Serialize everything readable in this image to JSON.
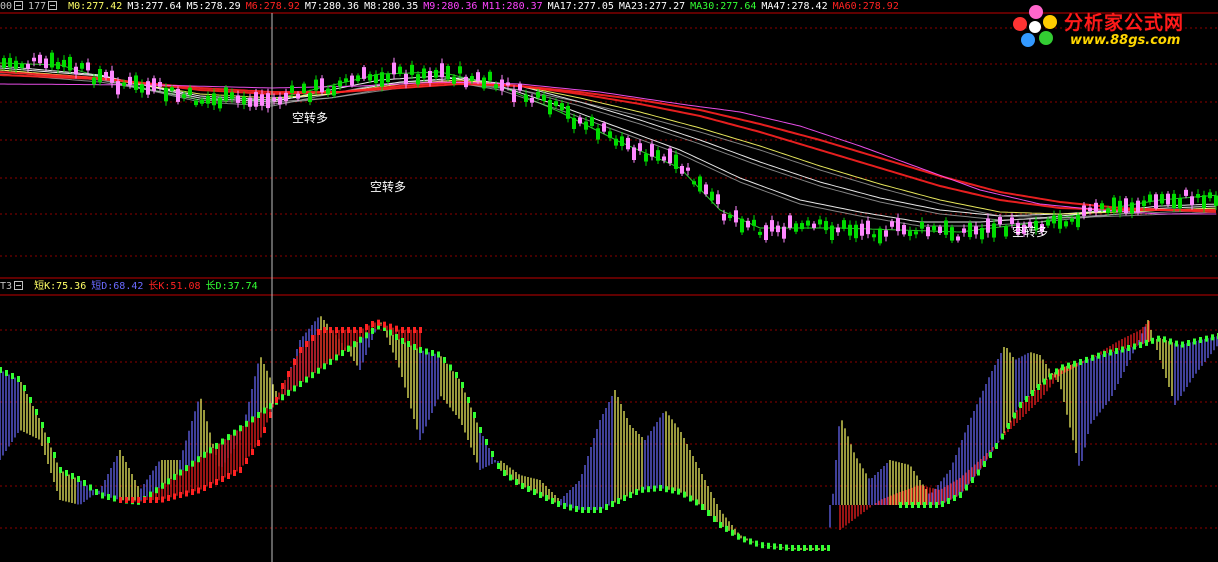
{
  "upper_panel": {
    "id_label": "00",
    "formula_label": "177",
    "indicators": [
      {
        "label": "M0:277.42",
        "color": "#ffff66"
      },
      {
        "label": "M3:277.64",
        "color": "#ffffff"
      },
      {
        "label": "M5:278.29",
        "color": "#ffffff"
      },
      {
        "label": "M6:278.92",
        "color": "#ff2222"
      },
      {
        "label": "M7:280.36",
        "color": "#ffffff"
      },
      {
        "label": "M8:280.35",
        "color": "#ffffff"
      },
      {
        "label": "M9:280.36",
        "color": "#ff44ff"
      },
      {
        "label": "M11:280.37",
        "color": "#ff44ff"
      },
      {
        "label": "MA17:277.05",
        "color": "#ffffff"
      },
      {
        "label": "MA23:277.27",
        "color": "#ffffff"
      },
      {
        "label": "MA30:277.64",
        "color": "#33ff33"
      },
      {
        "label": "MA47:278.42",
        "color": "#ffffff"
      },
      {
        "label": "MA60:278.92",
        "color": "#ff2222"
      }
    ],
    "annotations": [
      {
        "text": "空转多",
        "color": "#ffffff"
      },
      {
        "text": "空转多",
        "color": "#ffffff"
      },
      {
        "text": "空转多",
        "color": "#ffffff"
      }
    ]
  },
  "lower_panel": {
    "id_label": "T3",
    "indicators": [
      {
        "label": "短K:75.36",
        "color": "#ffff66"
      },
      {
        "label": "短D:68.42",
        "color": "#6a6aff"
      },
      {
        "label": "长K:51.08",
        "color": "#ff2222"
      },
      {
        "label": "长D:37.74",
        "color": "#33ff33"
      }
    ]
  },
  "logo": {
    "title": "分析家公式网",
    "url": "www.88gs.com"
  },
  "colors": {
    "background": "#000000",
    "grid": "#8b0000",
    "separator": "#c00000",
    "cursor": "#c0c0c0",
    "candle_up": "#ff88ff",
    "candle_down": "#00dd00",
    "short_k_rising": "#6a6aff",
    "short_k_falling": "#ffff66",
    "long_k_rising": "#ff2222",
    "long_d": "#33ff33"
  },
  "chart_data": [
    {
      "type": "candlestick",
      "title": "",
      "panel": "upper",
      "series": [
        {
          "name": "M0",
          "y_at_x": [
            [
              0,
              63
            ],
            [
              60,
              65
            ],
            [
              120,
              83
            ],
            [
              200,
              100
            ],
            [
              272,
              100
            ],
            [
              320,
              88
            ],
            [
              380,
              74
            ],
            [
              440,
              72
            ],
            [
              500,
              86
            ],
            [
              560,
              112
            ],
            [
              620,
              142
            ],
            [
              680,
              168
            ],
            [
              720,
              210
            ],
            [
              760,
              228
            ],
            [
              840,
              228
            ],
            [
              900,
              230
            ],
            [
              960,
              232
            ],
            [
              1040,
              222
            ],
            [
              1100,
              210
            ],
            [
              1160,
              200
            ],
            [
              1218,
              195
            ]
          ]
        },
        {
          "name": "MA17",
          "y_at_x": [
            [
              0,
              66
            ],
            [
              100,
              75
            ],
            [
              200,
              98
            ],
            [
              272,
              102
            ],
            [
              320,
              92
            ],
            [
              380,
              80
            ],
            [
              440,
              76
            ],
            [
              500,
              86
            ],
            [
              560,
              106
            ],
            [
              620,
              128
            ],
            [
              680,
              150
            ],
            [
              740,
              178
            ],
            [
              800,
              200
            ],
            [
              860,
              212
            ],
            [
              920,
              222
            ],
            [
              980,
              222
            ],
            [
              1040,
              218
            ],
            [
              1100,
              212
            ],
            [
              1160,
              206
            ],
            [
              1218,
              204
            ]
          ]
        },
        {
          "name": "MA23",
          "y_at_x": [
            [
              0,
              68
            ],
            [
              100,
              76
            ],
            [
              200,
              96
            ],
            [
              272,
              100
            ],
            [
              330,
              94
            ],
            [
              400,
              82
            ],
            [
              460,
              78
            ],
            [
              520,
              86
            ],
            [
              580,
              102
            ],
            [
              640,
              120
            ],
            [
              700,
              140
            ],
            [
              760,
              162
            ],
            [
              820,
              182
            ],
            [
              880,
              198
            ],
            [
              940,
              210
            ],
            [
              1000,
              216
            ],
            [
              1060,
              214
            ],
            [
              1120,
              210
            ],
            [
              1218,
              206
            ]
          ]
        },
        {
          "name": "MA30",
          "y_at_x": [
            [
              0,
              70
            ],
            [
              100,
              78
            ],
            [
              200,
              94
            ],
            [
              272,
              98
            ],
            [
              330,
              94
            ],
            [
              400,
              84
            ],
            [
              460,
              80
            ],
            [
              520,
              86
            ],
            [
              580,
              98
            ],
            [
              640,
              112
            ],
            [
              700,
              128
            ],
            [
              760,
              146
            ],
            [
              820,
              166
            ],
            [
              880,
              184
            ],
            [
              940,
              200
            ],
            [
              1000,
              212
            ],
            [
              1060,
              214
            ],
            [
              1120,
              212
            ],
            [
              1218,
              208
            ]
          ]
        },
        {
          "name": "MA47",
          "y_at_x": [
            [
              0,
              72
            ],
            [
              100,
              78
            ],
            [
              200,
              90
            ],
            [
              272,
              94
            ],
            [
              340,
              92
            ],
            [
              400,
              86
            ],
            [
              460,
              82
            ],
            [
              520,
              86
            ],
            [
              580,
              94
            ],
            [
              640,
              104
            ],
            [
              700,
              116
            ],
            [
              760,
              132
            ],
            [
              820,
              150
            ],
            [
              880,
              168
            ],
            [
              940,
              186
            ],
            [
              1000,
              200
            ],
            [
              1060,
              208
            ],
            [
              1120,
              210
            ],
            [
              1218,
              210
            ]
          ]
        },
        {
          "name": "MA60",
          "y_at_x": [
            [
              0,
              75
            ],
            [
              100,
              79
            ],
            [
              200,
              88
            ],
            [
              272,
              92
            ],
            [
              340,
              92
            ],
            [
              400,
              88
            ],
            [
              460,
              84
            ],
            [
              520,
              86
            ],
            [
              580,
              92
            ],
            [
              640,
              100
            ],
            [
              700,
              110
            ],
            [
              760,
              124
            ],
            [
              820,
              140
            ],
            [
              880,
              158
            ],
            [
              940,
              176
            ],
            [
              1000,
              192
            ],
            [
              1060,
              202
            ],
            [
              1120,
              208
            ],
            [
              1218,
              212
            ]
          ]
        },
        {
          "name": "M9",
          "y_at_x": [
            [
              0,
              84
            ],
            [
              150,
              85
            ],
            [
              272,
              88
            ],
            [
              360,
              86
            ],
            [
              440,
              82
            ],
            [
              520,
              84
            ],
            [
              600,
              92
            ],
            [
              680,
              104
            ],
            [
              740,
              112
            ],
            [
              800,
              126
            ],
            [
              860,
              146
            ],
            [
              920,
              168
            ],
            [
              980,
              190
            ],
            [
              1040,
              204
            ],
            [
              1100,
              210
            ],
            [
              1160,
              214
            ],
            [
              1218,
              214
            ]
          ]
        }
      ]
    },
    {
      "type": "bar",
      "title": "",
      "panel": "lower",
      "series": [
        {
          "name": "短K",
          "values_at_x": [
            [
              0,
              460
            ],
            [
              20,
              430
            ],
            [
              40,
              440
            ],
            [
              60,
              500
            ],
            [
              80,
              505
            ],
            [
              100,
              490
            ],
            [
              120,
              450
            ],
            [
              140,
              490
            ],
            [
              160,
              460
            ],
            [
              180,
              460
            ],
            [
              200,
              395
            ],
            [
              220,
              470
            ],
            [
              240,
              440
            ],
            [
              260,
              355
            ],
            [
              280,
              400
            ],
            [
              300,
              340
            ],
            [
              320,
              315
            ],
            [
              340,
              340
            ],
            [
              360,
              370
            ],
            [
              380,
              320
            ],
            [
              400,
              370
            ],
            [
              420,
              440
            ],
            [
              440,
              395
            ],
            [
              460,
              420
            ],
            [
              480,
              470
            ],
            [
              500,
              460
            ],
            [
              520,
              475
            ],
            [
              540,
              480
            ],
            [
              560,
              500
            ],
            [
              580,
              480
            ],
            [
              600,
              420
            ],
            [
              615,
              390
            ],
            [
              630,
              425
            ],
            [
              645,
              440
            ],
            [
              665,
              410
            ],
            [
              680,
              430
            ],
            [
              700,
              470
            ],
            [
              720,
              510
            ],
            [
              740,
              535
            ],
            [
              760,
              545
            ],
            [
              780,
              548
            ],
            [
              800,
              550
            ],
            [
              828,
              550
            ],
            [
              840,
              415
            ],
            [
              855,
              455
            ],
            [
              870,
              480
            ],
            [
              890,
              460
            ],
            [
              910,
              465
            ],
            [
              930,
              495
            ],
            [
              950,
              470
            ],
            [
              970,
              420
            ],
            [
              990,
              375
            ],
            [
              1005,
              345
            ],
            [
              1015,
              360
            ],
            [
              1030,
              352
            ],
            [
              1040,
              355
            ],
            [
              1060,
              385
            ],
            [
              1080,
              470
            ],
            [
              1090,
              425
            ],
            [
              1110,
              400
            ],
            [
              1130,
              360
            ],
            [
              1148,
              320
            ],
            [
              1160,
              360
            ],
            [
              1175,
              405
            ],
            [
              1195,
              375
            ],
            [
              1218,
              345
            ]
          ]
        },
        {
          "name": "长K",
          "values_at_x": [
            [
              120,
              500
            ],
            [
              160,
              500
            ],
            [
              200,
              490
            ],
            [
              240,
              470
            ],
            [
              260,
              440
            ],
            [
              280,
              390
            ],
            [
              300,
              350
            ],
            [
              320,
              330
            ],
            [
              340,
              330
            ],
            [
              360,
              330
            ],
            [
              376,
              322
            ],
            [
              400,
              330
            ]
          ]
        },
        {
          "name": "长D",
          "values_at_x": [
            [
              0,
              370
            ],
            [
              20,
              380
            ],
            [
              40,
              420
            ],
            [
              60,
              470
            ],
            [
              80,
              480
            ],
            [
              100,
              495
            ],
            [
              120,
              500
            ],
            [
              140,
              502
            ],
            [
              380,
              325
            ],
            [
              400,
              340
            ],
            [
              420,
              350
            ],
            [
              440,
              355
            ],
            [
              460,
              380
            ],
            [
              480,
              430
            ],
            [
              500,
              470
            ],
            [
              520,
              485
            ],
            [
              540,
              495
            ],
            [
              560,
              505
            ],
            [
              580,
              510
            ],
            [
              600,
              510
            ],
            [
              620,
              500
            ],
            [
              640,
              490
            ],
            [
              660,
              488
            ],
            [
              680,
              492
            ],
            [
              700,
              505
            ],
            [
              720,
              525
            ],
            [
              740,
              538
            ],
            [
              760,
              545
            ],
            [
              790,
              548
            ],
            [
              828,
              548
            ]
          ]
        }
      ]
    }
  ]
}
